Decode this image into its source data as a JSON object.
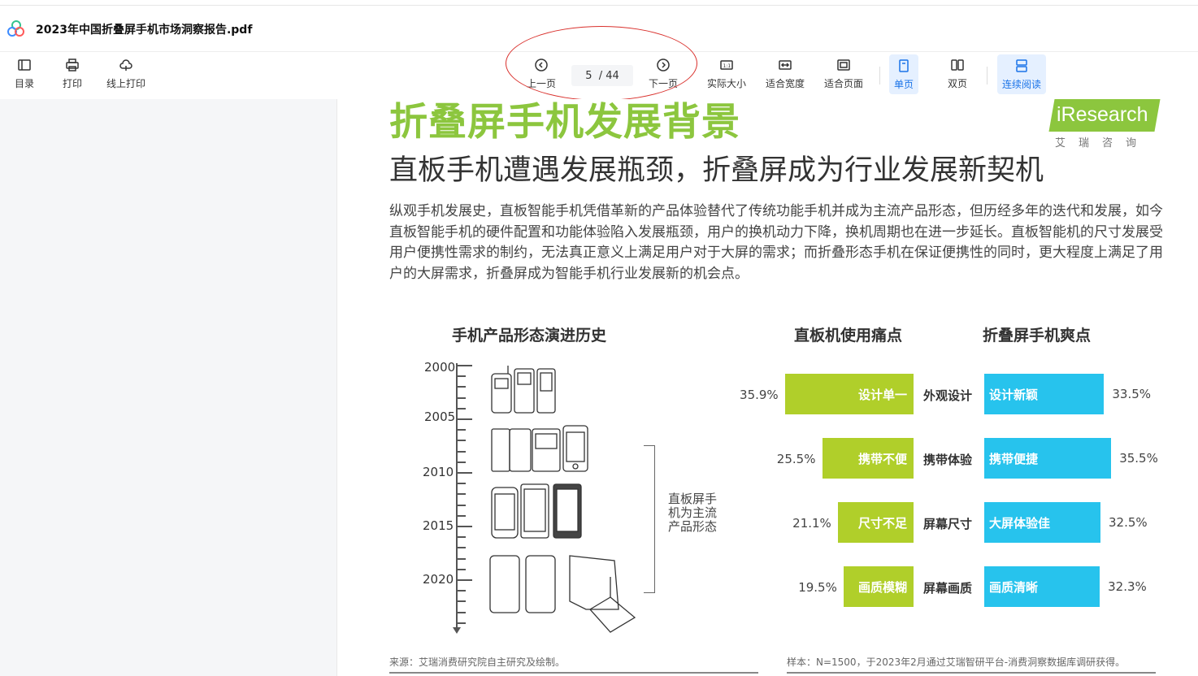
{
  "app": {
    "file_title": "2023年中国折叠屏手机市场洞察报告.pdf"
  },
  "toolbar": {
    "toc": "目录",
    "print": "打印",
    "online_print": "线上打印",
    "prev": "上一页",
    "page_current": "5",
    "page_sep": "/",
    "page_total": "44",
    "next": "下一页",
    "actual_size": "实际大小",
    "fit_width": "适合宽度",
    "fit_page": "适合页面",
    "single": "单页",
    "double": "双页",
    "continuous": "连续阅读",
    "active_color": "#1a73e8"
  },
  "doc": {
    "main_title": "折叠屏手机发展背景",
    "sub_title": "直板手机遭遇发展瓶颈，折叠屏成为行业发展新契机",
    "paragraph": "纵观手机发展史，直板智能手机凭借革新的产品体验替代了传统功能手机并成为主流产品形态，但历经多年的迭代和发展，如今直板智能手机的硬件配置和功能体验陷入发展瓶颈，用户的换机动力下降，换机周期也在进一步延长。直板智能机的尺寸发展受用户便携性需求的制约，无法真正意义上满足用户对于大屏的需求；而折叠形态手机在保证便携性的同时，更大程度上满足了用户的大屏需求，折叠屏成为智能手机行业发展新的机会点。",
    "logo_text": "iResearch",
    "logo_sub": "艾瑞咨询",
    "history_title": "手机产品形态演进历史",
    "years": [
      "2000",
      "2005",
      "2010",
      "2015",
      "2020"
    ],
    "bracket_text": "直板屏手机为主流产品形态",
    "pain_title": "直板机使用痛点",
    "fold_title": "折叠屏手机爽点",
    "source_left": "来源：艾瑞消费研究院自主研究及绘制。",
    "source_right": "样本：N=1500，于2023年2月通过艾瑞智研平台-消费洞察数据库调研获得。",
    "brand_green": "#8cc63e",
    "bar_green": "#b0cf2a",
    "bar_blue": "#27c3ed"
  },
  "chart_data": {
    "type": "bar",
    "categories": [
      "外观设计",
      "携带体验",
      "屏幕尺寸",
      "屏幕画质"
    ],
    "series": [
      {
        "name": "直板机使用痛点",
        "labels": [
          "设计单一",
          "携带不便",
          "尺寸不足",
          "画质模糊"
        ],
        "values": [
          35.9,
          25.5,
          21.1,
          19.5
        ],
        "value_labels": [
          "35.9%",
          "25.5%",
          "21.1%",
          "19.5%"
        ]
      },
      {
        "name": "折叠屏手机爽点",
        "labels": [
          "设计新颖",
          "携带便捷",
          "大屏体验佳",
          "画质清晰"
        ],
        "values": [
          33.5,
          35.5,
          32.5,
          32.3
        ],
        "value_labels": [
          "33.5%",
          "35.5%",
          "32.5%",
          "32.3%"
        ]
      }
    ]
  }
}
